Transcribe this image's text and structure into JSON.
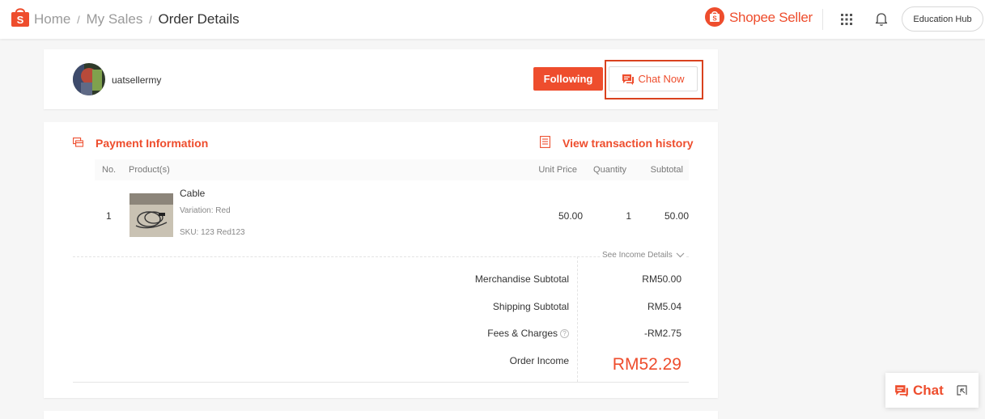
{
  "header": {
    "breadcrumb": [
      "Home",
      "My Sales",
      "Order Details"
    ],
    "separator": "/",
    "brand": "Shopee Seller",
    "education_hub": "Education Hub",
    "icons": {
      "logo": "shopee-bag-icon",
      "apps": "apps-grid-icon",
      "notifications": "bell-icon"
    }
  },
  "buyer": {
    "username": "uatsellermy",
    "follow_label": "Following",
    "chat_label": "Chat Now"
  },
  "payment": {
    "title": "Payment Information",
    "history_link": "View transaction history",
    "columns": {
      "no": "No.",
      "product": "Product(s)",
      "unit_price": "Unit Price",
      "quantity": "Quantity",
      "subtotal": "Subtotal"
    },
    "items": [
      {
        "no": "1",
        "name": "Cable",
        "variation": "Variation: Red",
        "sku": "SKU: 123 Red123",
        "unit_price": "50.00",
        "quantity": "1",
        "subtotal": "50.00"
      }
    ],
    "income_details_label": "See Income Details",
    "summary": [
      {
        "label": "Merchandise Subtotal",
        "value": "RM50.00"
      },
      {
        "label": "Shipping Subtotal",
        "value": "RM5.04"
      },
      {
        "label": "Fees & Charges",
        "value": "-RM2.75",
        "help": "?"
      }
    ],
    "order_income_label": "Order Income",
    "order_income_value": "RM52.29"
  },
  "float_chat": {
    "label": "Chat"
  },
  "colors": {
    "brand": "#ee4d2d",
    "highlight_border": "#d9421f"
  }
}
